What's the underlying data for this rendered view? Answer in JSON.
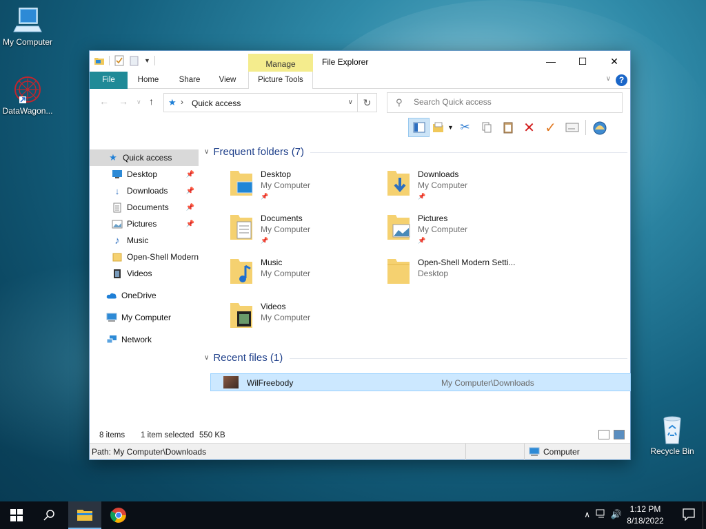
{
  "desktop": {
    "icons": [
      {
        "label": "My Computer"
      },
      {
        "label": "DataWagon..."
      },
      {
        "label": "Recycle Bin"
      }
    ]
  },
  "window": {
    "title": "File Explorer",
    "contextual_tab_group": "Manage",
    "ribbon_tabs": [
      "File",
      "Home",
      "Share",
      "View",
      "Picture Tools"
    ],
    "help_glyph": "?",
    "address": {
      "location": "Quick access"
    },
    "search": {
      "placeholder": "Search Quick access"
    },
    "nav_pane": {
      "items": [
        {
          "label": "Quick access",
          "icon": "star-icon",
          "pinned": false
        },
        {
          "label": "Desktop",
          "icon": "desktop-icon",
          "pinned": true
        },
        {
          "label": "Downloads",
          "icon": "download-icon",
          "pinned": true
        },
        {
          "label": "Documents",
          "icon": "document-icon",
          "pinned": true
        },
        {
          "label": "Pictures",
          "icon": "picture-icon",
          "pinned": true
        },
        {
          "label": "Music",
          "icon": "music-icon",
          "pinned": false
        },
        {
          "label": "Open-Shell Modern",
          "icon": "folder-icon",
          "pinned": false
        },
        {
          "label": "Videos",
          "icon": "video-icon",
          "pinned": false
        },
        {
          "label": "OneDrive",
          "icon": "cloud-icon",
          "pinned": false
        },
        {
          "label": "My Computer",
          "icon": "computer-icon",
          "pinned": false
        },
        {
          "label": "Network",
          "icon": "network-icon",
          "pinned": false
        }
      ]
    },
    "frequent_folders": {
      "header": "Frequent folders (7)",
      "items": [
        {
          "name": "Desktop",
          "location": "My Computer",
          "pinned": true
        },
        {
          "name": "Downloads",
          "location": "My Computer",
          "pinned": true
        },
        {
          "name": "Documents",
          "location": "My Computer",
          "pinned": true
        },
        {
          "name": "Pictures",
          "location": "My Computer",
          "pinned": true
        },
        {
          "name": "Music",
          "location": "My Computer",
          "pinned": false
        },
        {
          "name": "Open-Shell Modern Setti...",
          "location": "Desktop",
          "pinned": false
        },
        {
          "name": "Videos",
          "location": "My Computer",
          "pinned": false
        }
      ]
    },
    "recent_files": {
      "header": "Recent files (1)",
      "items": [
        {
          "name": "WilFreebody",
          "path": "My Computer\\Downloads"
        }
      ]
    },
    "status": {
      "item_count": "8 items",
      "selection": "1 item selected",
      "size": "550 KB"
    },
    "pathbar": {
      "path": "Path: My Computer\\Downloads",
      "location_label": "Computer"
    }
  },
  "taskbar": {
    "time": "1:12 PM",
    "date": "8/18/2022"
  },
  "colors": {
    "file_tab": "#1f8a97",
    "manage_tab": "#f4ec8d",
    "selection": "#cce8ff",
    "group_header": "#1e3f8a"
  }
}
